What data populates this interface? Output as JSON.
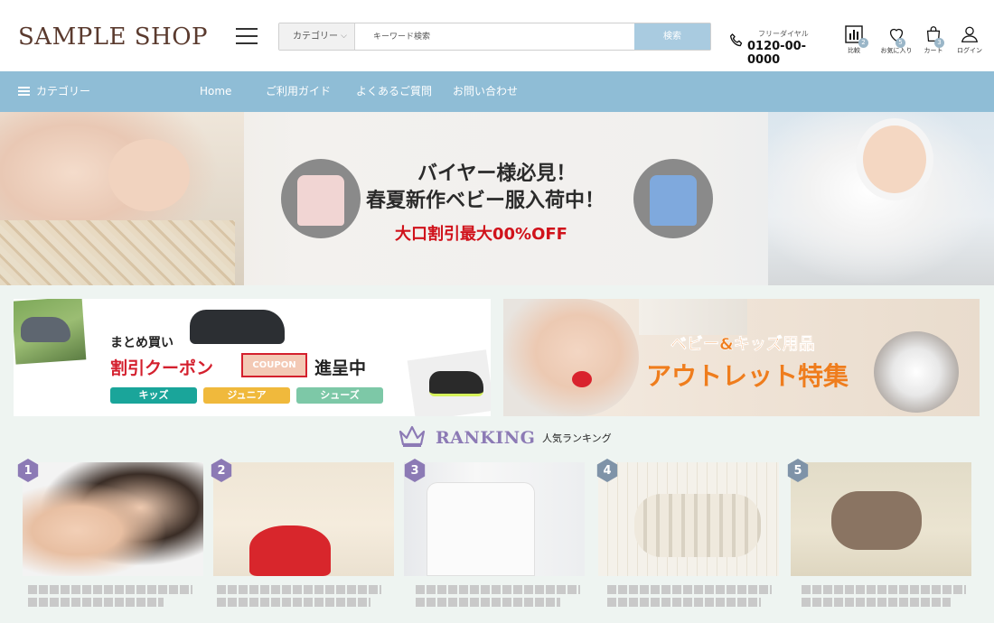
{
  "header": {
    "logo": "SAMPLE SHOP",
    "search": {
      "category_label": "カテゴリー",
      "placeholder": "キーワード検索",
      "button_label": "検索"
    },
    "phone": {
      "label": "フリーダイヤル",
      "number": "0120-00-0000"
    },
    "icons": [
      {
        "name": "compare",
        "label": "比較",
        "badge": "2"
      },
      {
        "name": "favorites",
        "label": "お気に入り",
        "badge": "5"
      },
      {
        "name": "cart",
        "label": "カート",
        "badge": "3"
      },
      {
        "name": "login",
        "label": "ログイン",
        "badge": ""
      }
    ]
  },
  "nav": {
    "category_label": "カテゴリー",
    "links": [
      "Home",
      "ご利用ガイド",
      "よくあるご質問",
      "お問い合わせ"
    ]
  },
  "hero": {
    "line1": "バイヤー様必見！",
    "line2": "春夏新作ベビー服入荷中！",
    "line3": "大口割引最大00%OFF"
  },
  "banner_left": {
    "line1": "まとめ買い",
    "line2": "割引クーポン",
    "coupon": "COUPON",
    "line3": "進呈中",
    "pills": [
      "キッズ",
      "ジュニア",
      "シューズ"
    ],
    "pill_colors": [
      "#1aa59a",
      "#f0b93c",
      "#7dc8a7"
    ]
  },
  "banner_right": {
    "line1": "ベビー&キッズ用品",
    "line2": "アウトレット特集"
  },
  "ranking": {
    "title": "RANKING",
    "subtitle": "人気ランキング",
    "items": [
      {
        "rank": "1"
      },
      {
        "rank": "2"
      },
      {
        "rank": "3"
      },
      {
        "rank": "4"
      },
      {
        "rank": "5"
      }
    ]
  },
  "colors": {
    "brand_text": "#5a3a2e",
    "nav_bg": "#8fbdd6",
    "ranking_purple": "#8c7ab5",
    "sale_red": "#d0121b",
    "outlet_orange": "#ef7d1d",
    "page_bg": "#eef4f1"
  }
}
